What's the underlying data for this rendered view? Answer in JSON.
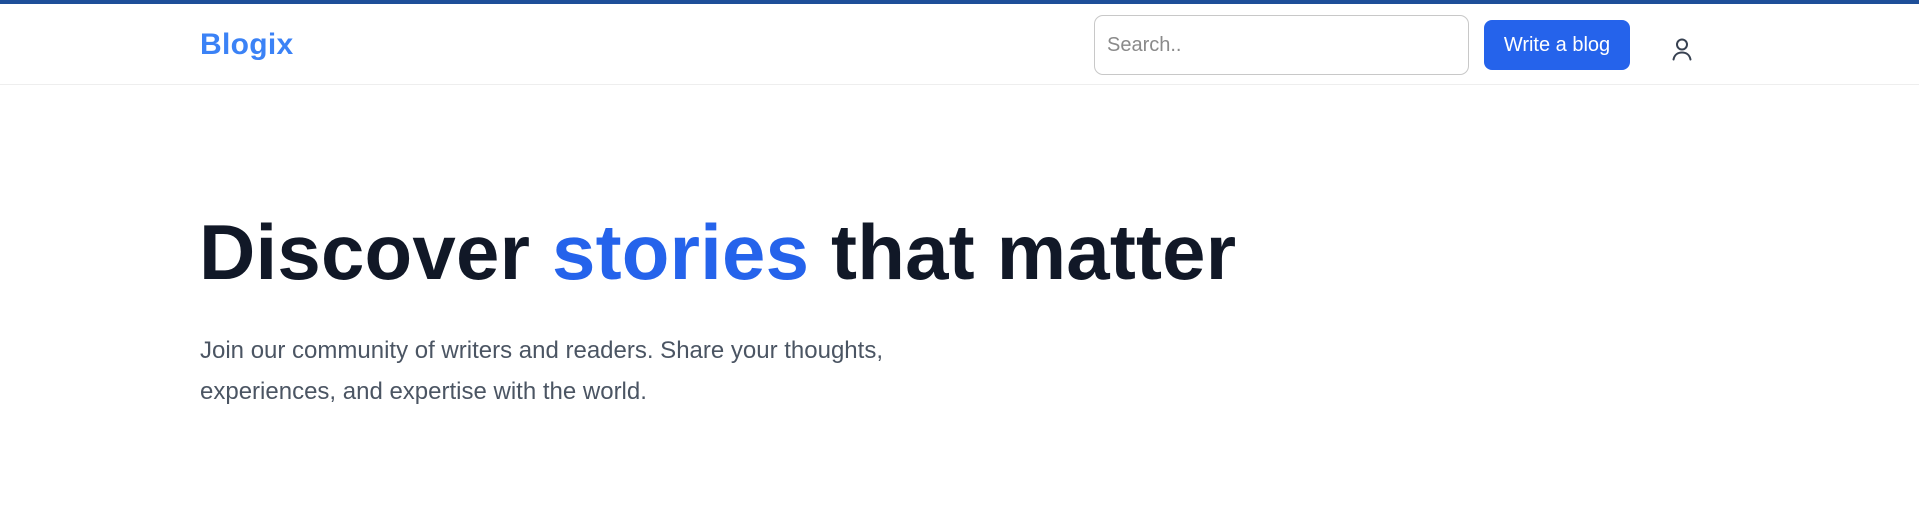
{
  "colors": {
    "accent": "#2563eb",
    "logo": "#3b82f6",
    "heading": "#111827",
    "body_text": "#4b5563",
    "top_accent_bar": "#1e4f99"
  },
  "header": {
    "logo": "Blogix",
    "search": {
      "placeholder": "Search..",
      "value": ""
    },
    "write_button_label": "Write a blog",
    "user_icon": "user-icon"
  },
  "hero": {
    "title_part1": "Discover ",
    "title_highlight": "stories",
    "title_part2": " that matter",
    "subtitle": "Join our community of writers and readers. Share your thoughts, experiences, and expertise with the world."
  }
}
